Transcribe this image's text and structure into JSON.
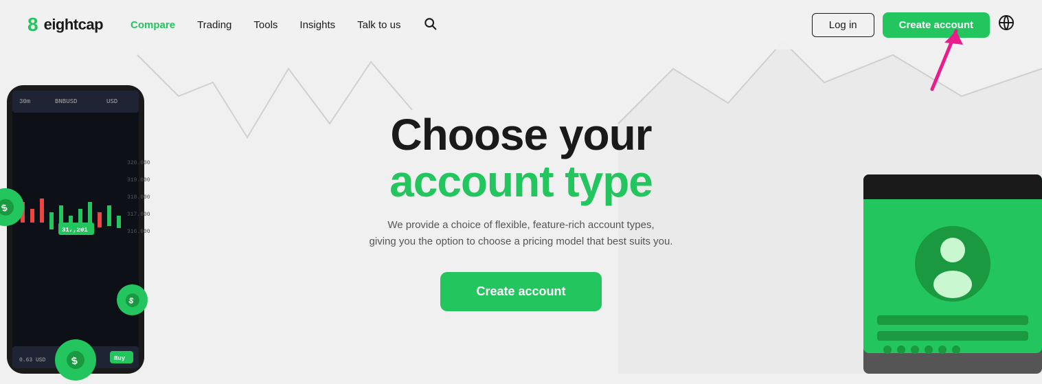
{
  "logo": {
    "icon": "8",
    "text": "eightcap"
  },
  "nav": {
    "items": [
      {
        "label": "Compare",
        "active": true
      },
      {
        "label": "Trading",
        "active": false
      },
      {
        "label": "Tools",
        "active": false
      },
      {
        "label": "Insights",
        "active": false
      },
      {
        "label": "Talk to us",
        "active": false
      }
    ]
  },
  "header": {
    "login_label": "Log in",
    "create_label": "Create account"
  },
  "hero": {
    "title_line1": "Choose your",
    "title_line2": "account type",
    "subtitle_line1": "We provide a choice of flexible, feature-rich account types,",
    "subtitle_line2": "giving you the option to choose a pricing model that best suits you.",
    "cta_label": "Create account"
  },
  "colors": {
    "green": "#22c55e",
    "dark": "#1a1a1a",
    "gray": "#555555"
  }
}
